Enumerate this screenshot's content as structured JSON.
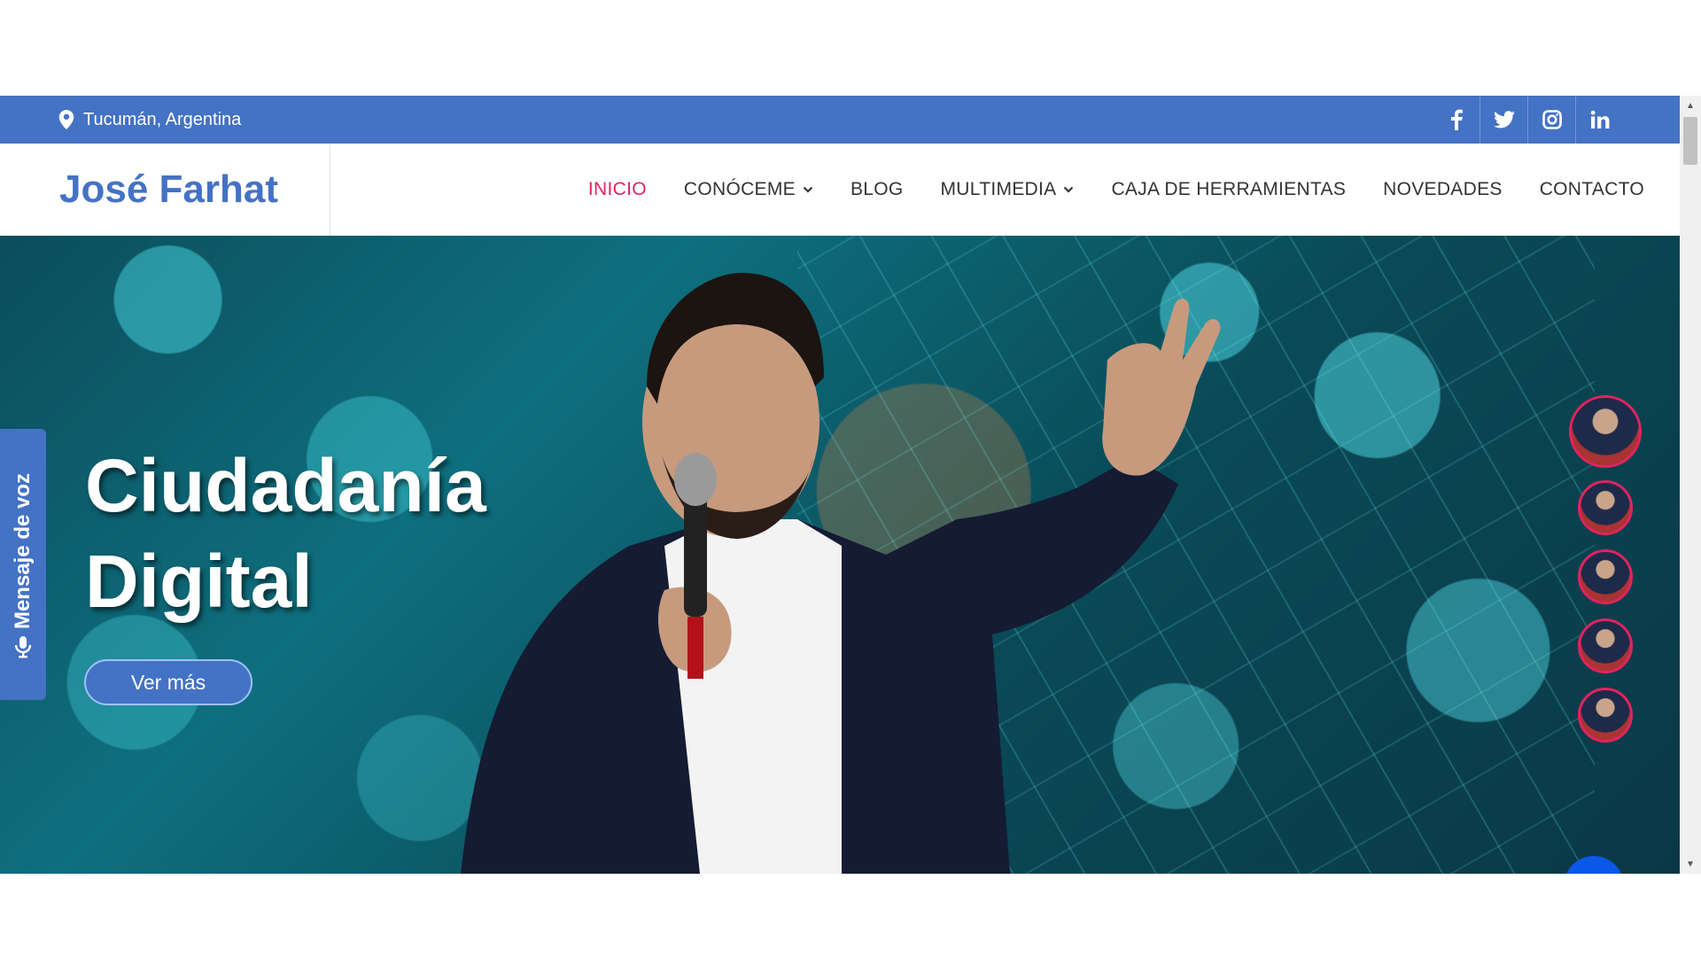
{
  "topbar": {
    "location": "Tucumán, Argentina",
    "social": [
      {
        "icon": "facebook-icon",
        "glyph": "f"
      },
      {
        "icon": "twitter-icon",
        "glyph": "t"
      },
      {
        "icon": "instagram-icon",
        "glyph": "ig"
      },
      {
        "icon": "linkedin-icon",
        "glyph": "in"
      }
    ]
  },
  "header": {
    "brand": "José Farhat",
    "nav": [
      {
        "label": "INICIO",
        "active": true
      },
      {
        "label": "CONÓCEME",
        "dropdown": true
      },
      {
        "label": "BLOG"
      },
      {
        "label": "MULTIMEDIA",
        "dropdown": true
      },
      {
        "label": "CAJA DE HERRAMIENTAS"
      },
      {
        "label": "NOVEDADES"
      },
      {
        "label": "CONTACTO"
      }
    ]
  },
  "hero": {
    "title_line1": "Ciudadanía",
    "title_line2": "Digital",
    "cta": "Ver más"
  },
  "voice_tab": {
    "label": "Mensaje de voz",
    "icon": "microphone-icon"
  },
  "colors": {
    "primary": "#4472c4",
    "active_nav": "#e0245e",
    "scroll_top": "#0b57e8"
  }
}
